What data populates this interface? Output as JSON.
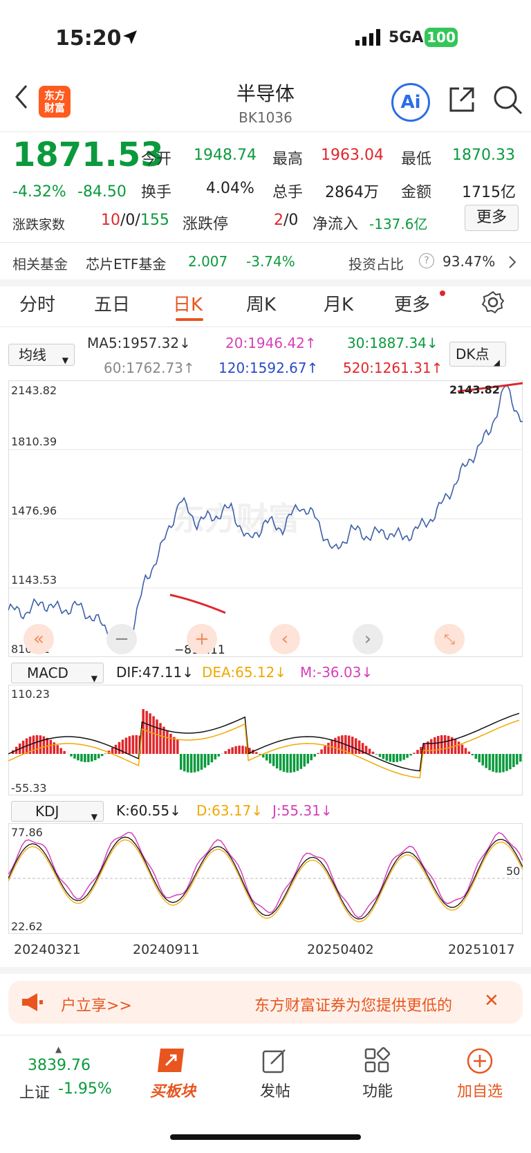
{
  "status": {
    "time": "15:20",
    "network": "5GA",
    "battery": "100"
  },
  "header": {
    "title": "半导体",
    "code": "BK1036",
    "logo_text": "东方财富",
    "ai_label": "Ai"
  },
  "quote": {
    "price": "1871.53",
    "change_pct": "-4.32%",
    "change": "-84.50",
    "open_label": "今开",
    "open": "1948.74",
    "high_label": "最高",
    "high": "1963.04",
    "low_label": "最低",
    "low": "1870.33",
    "turnover_label": "换手",
    "turnover": "4.04%",
    "volume_label": "总手",
    "volume": "2864万",
    "amount_label": "金额",
    "amount": "1715亿",
    "breadth_label": "涨跌家数",
    "breadth_up": "10",
    "breadth_flat": "0",
    "breadth_down": "155",
    "limit_label": "涨跌停",
    "limit_up": "2",
    "limit_down": "0",
    "netflow_label": "净流入",
    "netflow": "-137.6亿",
    "more_label": "更多"
  },
  "fund": {
    "label": "相关基金",
    "name": "芯片ETF基金",
    "value": "2.007",
    "pct": "-3.74%",
    "ratio_label": "投资占比",
    "ratio": "93.47%"
  },
  "tabs": [
    {
      "label": "分时"
    },
    {
      "label": "五日"
    },
    {
      "label": "日K"
    },
    {
      "label": "周K"
    },
    {
      "label": "月K"
    },
    {
      "label": "更多"
    }
  ],
  "chart_header": {
    "indicator": "均线",
    "dk_label": "DK点",
    "ma5": "MA5:1957.32↓",
    "ma20": "20:1946.42↑",
    "ma30": "30:1887.34↓",
    "ma60": "60:1762.73↑",
    "ma120": "120:1592.67↑",
    "ma520": "520:1261.31↑"
  },
  "main_chart": {
    "y_labels": [
      "2143.82",
      "1810.39",
      "1476.96",
      "1143.53",
      "810.11"
    ],
    "high_marker": "2143.82",
    "low_marker": "810.11",
    "watermark": "东方财富"
  },
  "macd": {
    "selector": "MACD",
    "dif": "DIF:47.11↓",
    "dea": "DEA:65.12↓",
    "m": "M:-36.03↓",
    "y_top": "110.23",
    "y_bottom": "-55.33"
  },
  "kdj": {
    "selector": "KDJ",
    "k": "K:60.55↓",
    "d": "D:63.17↓",
    "j": "J:55.31↓",
    "y_top": "77.86",
    "y_mid": "50",
    "y_bottom": "22.62"
  },
  "x_labels": [
    "20240321",
    "20240911",
    "20250402",
    "20251017"
  ],
  "banner": {
    "left_text": "户立享>>",
    "right_text": "东方财富证券为您提供更低的"
  },
  "bottom_nav": {
    "index_value": "3839.76",
    "index_name": "上证",
    "index_pct": "-1.95%",
    "items": [
      {
        "label": "买板块"
      },
      {
        "label": "发帖"
      },
      {
        "label": "功能"
      },
      {
        "label": "加自选"
      }
    ]
  },
  "colors": {
    "up": "#e0262b",
    "down": "#0a9a3c",
    "accent": "#e8551e",
    "line": "#3d5fa8"
  },
  "chart_data": [
    {
      "type": "line",
      "title": "",
      "x": [
        "20240321",
        "20240911",
        "20250402",
        "20251017"
      ],
      "series": [
        {
          "values": [
            1000,
            990,
            1040,
            1000,
            1020,
            960,
            880,
            830,
            1150,
            1330,
            1560,
            1450,
            1480,
            1520,
            1350,
            1450,
            1420,
            1540,
            1460,
            1290,
            1410,
            1380,
            1400,
            1370,
            1420,
            1500,
            1640,
            1780,
            1900,
            2143,
            1960
          ]
        }
      ],
      "ylim": [
        810.11,
        2143.82
      ]
    }
  ]
}
